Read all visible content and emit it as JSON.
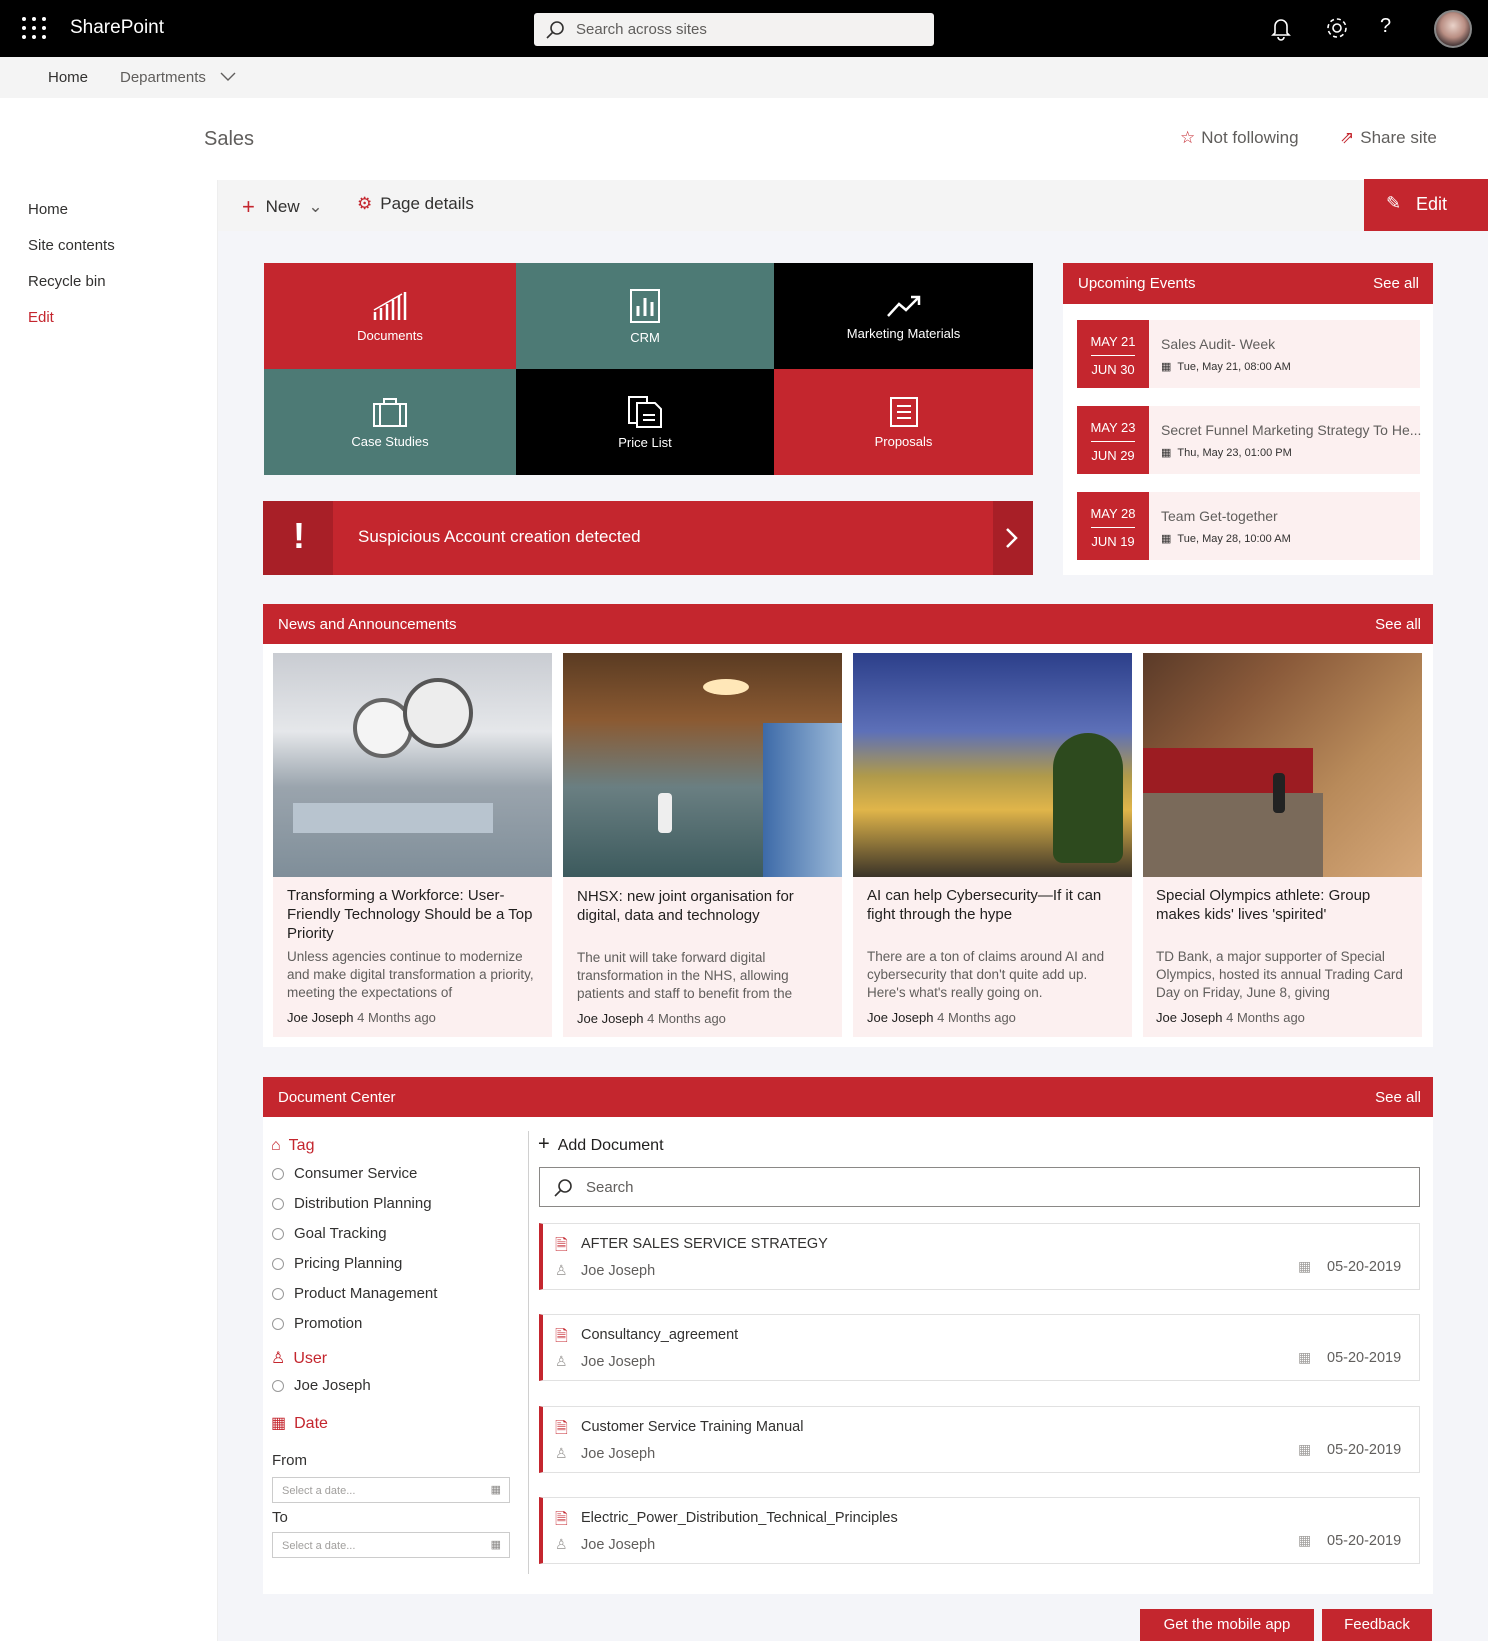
{
  "app": {
    "name": "SharePoint",
    "search_placeholder": "Search across sites"
  },
  "subnav": {
    "home": "Home",
    "departments": "Departments"
  },
  "site": {
    "title": "Sales",
    "follow": "Not following",
    "share": "Share site"
  },
  "leftnav": [
    {
      "label": "Home"
    },
    {
      "label": "Site contents"
    },
    {
      "label": "Recycle bin"
    },
    {
      "label": "Edit"
    }
  ],
  "commandbar": {
    "new": "New",
    "page_details": "Page details",
    "edit": "Edit"
  },
  "tiles": [
    {
      "label": "Documents",
      "icon": "chart-growth-icon"
    },
    {
      "label": "CRM",
      "icon": "bar-chart-icon"
    },
    {
      "label": "Marketing Materials",
      "icon": "trend-up-icon"
    },
    {
      "label": "Case Studies",
      "icon": "briefcase-icon"
    },
    {
      "label": "Price List",
      "icon": "documents-icon"
    },
    {
      "label": "Proposals",
      "icon": "document-lines-icon"
    }
  ],
  "alert": {
    "text": "Suspicious Account creation detected"
  },
  "events": {
    "title": "Upcoming Events",
    "see_all": "See all",
    "items": [
      {
        "start": "MAY 21",
        "end": "JUN 30",
        "title": "Sales Audit- Week",
        "when": "Tue, May 21, 08:00 AM"
      },
      {
        "start": "MAY 23",
        "end": "JUN 29",
        "title": "Secret Funnel Marketing Strategy To He...",
        "when": "Thu, May 23, 01:00 PM"
      },
      {
        "start": "MAY 28",
        "end": "JUN 19",
        "title": "Team Get-together",
        "when": "Tue, May 28, 10:00 AM"
      }
    ]
  },
  "news": {
    "title": "News and Announcements",
    "see_all": "See all",
    "items": [
      {
        "title": "Transforming a Workforce: User-Friendly Technology Should be a Top Priority",
        "desc": "Unless agencies continue to modernize and make digital transformation a priority, meeting the expectations of",
        "author": "Joe Joseph",
        "ago": "4 Months ago"
      },
      {
        "title": "NHSX: new joint organisation for digital, data and technology",
        "desc": "The unit will take forward digital transformation in the NHS, allowing patients and staff to benefit from the",
        "author": "Joe Joseph",
        "ago": "4 Months ago"
      },
      {
        "title": "AI can help Cybersecurity—If it can fight through the hype",
        "desc": "There are a ton of claims around AI and cybersecurity that don't quite add up. Here's what's really going on.",
        "author": "Joe Joseph",
        "ago": "4 Months ago"
      },
      {
        "title": "Special Olympics athlete: Group makes kids' lives 'spirited'",
        "desc": "TD Bank, a major supporter of Special Olympics, hosted its annual Trading Card Day on Friday, June 8, giving",
        "author": "Joe Joseph",
        "ago": "4 Months ago"
      }
    ]
  },
  "docs": {
    "title": "Document Center",
    "see_all": "See all",
    "add": "Add Document",
    "search": "Search",
    "filters": {
      "tag_label": "Tag",
      "tags": [
        "Consumer Service",
        "Distribution Planning",
        "Goal Tracking",
        "Pricing Planning",
        "Product Management",
        "Promotion"
      ],
      "user_label": "User",
      "users": [
        "Joe Joseph"
      ],
      "date_label": "Date",
      "from": "From",
      "to": "To",
      "date_placeholder": "Select a date..."
    },
    "items": [
      {
        "name": "AFTER SALES SERVICE STRATEGY",
        "author": "Joe Joseph",
        "date": "05-20-2019"
      },
      {
        "name": "Consultancy_agreement",
        "author": "Joe Joseph",
        "date": "05-20-2019"
      },
      {
        "name": "Customer Service Training Manual",
        "author": "Joe Joseph",
        "date": "05-20-2019"
      },
      {
        "name": "Electric_Power_Distribution_Technical_Principles",
        "author": "Joe Joseph",
        "date": "05-20-2019"
      }
    ]
  },
  "footer": {
    "mobile": "Get the mobile app",
    "feedback": "Feedback"
  }
}
